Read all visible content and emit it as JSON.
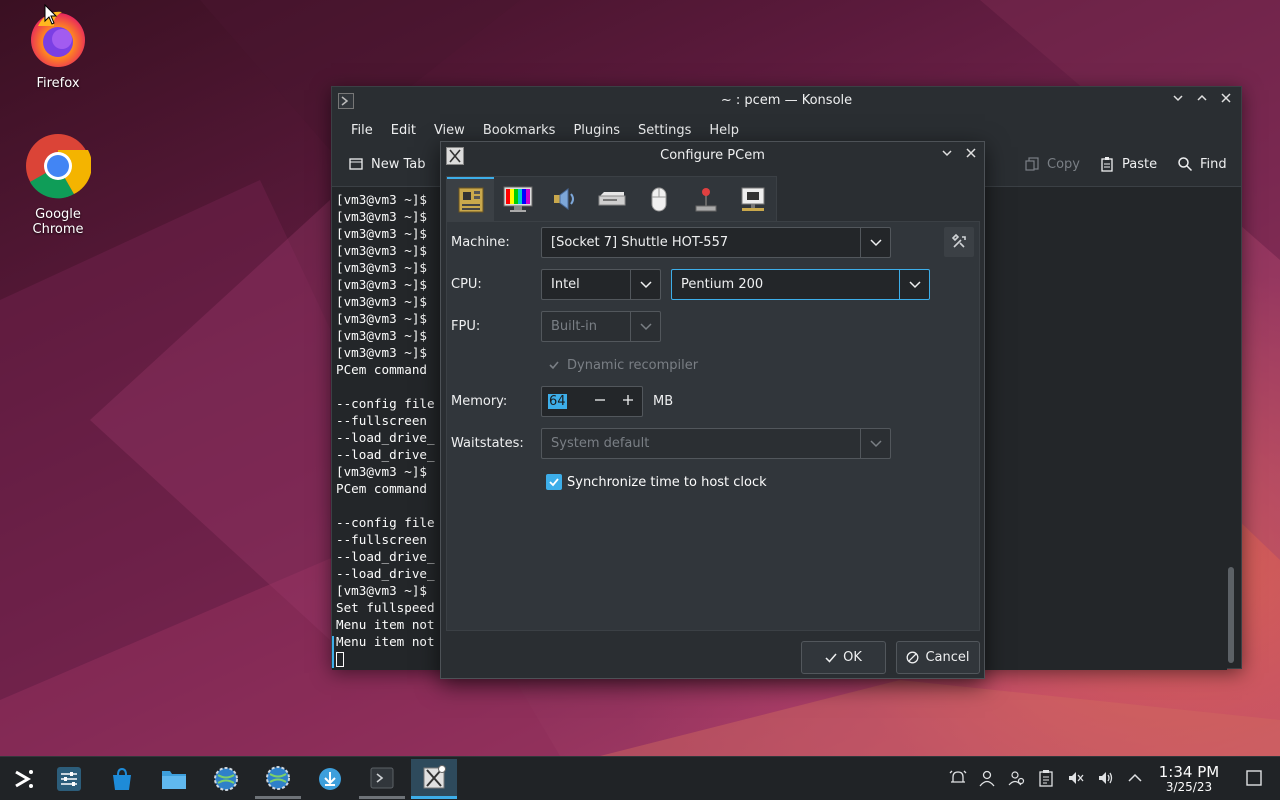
{
  "desktop": {
    "icons": [
      {
        "label": "Firefox"
      },
      {
        "label": "Google Chrome"
      }
    ]
  },
  "konsole": {
    "title": "~ : pcem — Konsole",
    "menu": [
      "File",
      "Edit",
      "View",
      "Bookmarks",
      "Plugins",
      "Settings",
      "Help"
    ],
    "toolbar": {
      "new_tab": "New Tab",
      "copy": "Copy",
      "paste": "Paste",
      "find": "Find"
    },
    "lines": [
      "[vm3@vm3 ~]$",
      "[vm3@vm3 ~]$",
      "[vm3@vm3 ~]$",
      "[vm3@vm3 ~]$",
      "[vm3@vm3 ~]$",
      "[vm3@vm3 ~]$",
      "[vm3@vm3 ~]$",
      "[vm3@vm3 ~]$",
      "[vm3@vm3 ~]$",
      "[vm3@vm3 ~]$",
      "PCem command",
      "",
      "--config file",
      "--fullscreen",
      "--load_drive_",
      "--load_drive_",
      "[vm3@vm3 ~]$",
      "PCem command",
      "",
      "--config file",
      "--fullscreen",
      "--load_drive_",
      "--load_drive_",
      "[vm3@vm3 ~]$",
      "Set fullspeed",
      "Menu item not",
      "Menu item not"
    ]
  },
  "dialog": {
    "title": "Configure PCem",
    "tabs": [
      "motherboard-icon",
      "display-icon",
      "sound-icon",
      "drives-icon",
      "mouse-icon",
      "joystick-icon",
      "network-icon"
    ],
    "machine_label": "Machine:",
    "machine_value": "[Socket 7] Shuttle HOT-557",
    "cpu_label": "CPU:",
    "cpu_vendor": "Intel",
    "cpu_model": "Pentium 200",
    "fpu_label": "FPU:",
    "fpu_value": "Built-in",
    "dynarec_label": "Dynamic recompiler",
    "memory_label": "Memory:",
    "memory_value": "64",
    "memory_unit": "MB",
    "waitstates_label": "Waitstates:",
    "waitstates_value": "System default",
    "sync_label": "Synchronize time to host clock",
    "ok_label": "OK",
    "cancel_label": "Cancel"
  },
  "taskbar": {
    "time": "1:34 PM",
    "date": "3/25/23"
  }
}
